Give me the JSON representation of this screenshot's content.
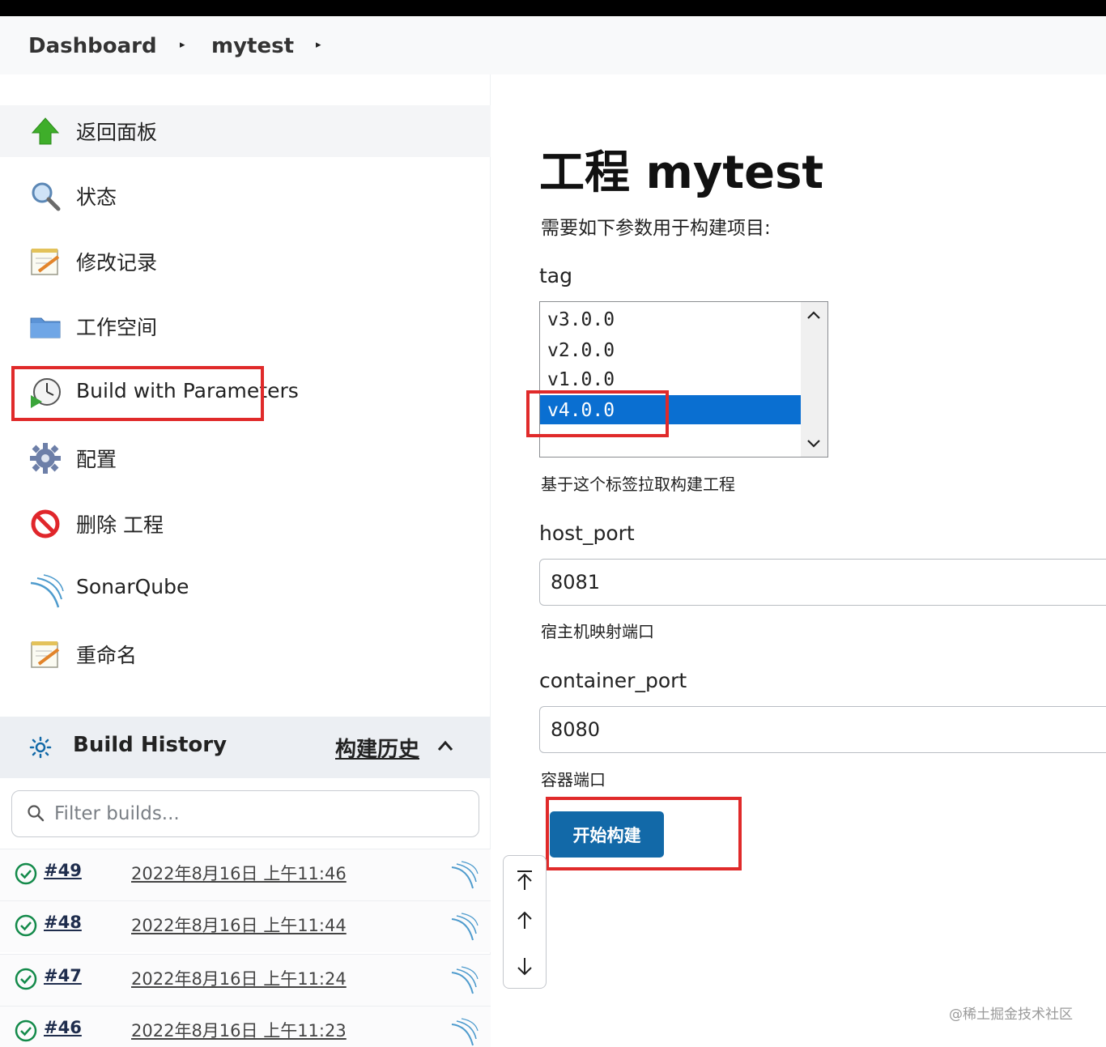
{
  "breadcrumb": {
    "items": [
      "Dashboard",
      "mytest"
    ]
  },
  "sidebar": {
    "items": [
      {
        "label": "返回面板",
        "icon": "up-arrow-icon"
      },
      {
        "label": "状态",
        "icon": "magnifier-icon"
      },
      {
        "label": "修改记录",
        "icon": "notepad-icon"
      },
      {
        "label": "工作空间",
        "icon": "folder-icon"
      },
      {
        "label": "Build with Parameters",
        "icon": "clock-play-icon"
      },
      {
        "label": "配置",
        "icon": "gear-icon"
      },
      {
        "label": "删除 工程",
        "icon": "no-entry-icon"
      },
      {
        "label": "SonarQube",
        "icon": "sonarqube-icon"
      },
      {
        "label": "重命名",
        "icon": "notepad-icon"
      }
    ]
  },
  "build_history": {
    "title": "Build History",
    "title_cn": "构建历史",
    "filter_placeholder": "Filter builds...",
    "builds": [
      {
        "number": "#49",
        "date": "2022年8月16日 上午11:46"
      },
      {
        "number": "#48",
        "date": "2022年8月16日 上午11:44"
      },
      {
        "number": "#47",
        "date": "2022年8月16日 上午11:24"
      },
      {
        "number": "#46",
        "date": "2022年8月16日 上午11:23"
      }
    ]
  },
  "main": {
    "title": "工程 mytest",
    "subtitle": "需要如下参数用于构建项目:",
    "params": {
      "tag": {
        "label": "tag",
        "options": [
          "v3.0.0",
          "v2.0.0",
          "v1.0.0",
          "v4.0.0"
        ],
        "selected": "v4.0.0",
        "description": "基于这个标签拉取构建工程"
      },
      "host_port": {
        "label": "host_port",
        "value": "8081",
        "description": "宿主机映射端口"
      },
      "container_port": {
        "label": "container_port",
        "value": "8080",
        "description": "容器端口"
      }
    },
    "build_button": "开始构建"
  },
  "watermark": "@稀土掘金技术社区",
  "colors": {
    "accent": "#1269a8",
    "selection": "#0a6fd1",
    "highlight_box": "#e02a2a",
    "success": "#138a4a"
  }
}
